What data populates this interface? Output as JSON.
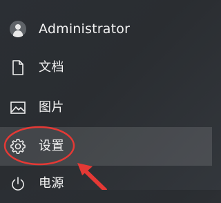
{
  "user": {
    "name": "Administrator",
    "icon": "avatar-icon"
  },
  "items": [
    {
      "label": "文档",
      "icon": "document-icon"
    },
    {
      "label": "图片",
      "icon": "picture-icon"
    },
    {
      "label": "设置",
      "icon": "gear-icon"
    },
    {
      "label": "电源",
      "icon": "power-icon"
    }
  ],
  "colors": {
    "annotation": "#e53935",
    "background": "#2b2f34",
    "highlight": "#3a3e43",
    "text": "#f3f3f3"
  }
}
